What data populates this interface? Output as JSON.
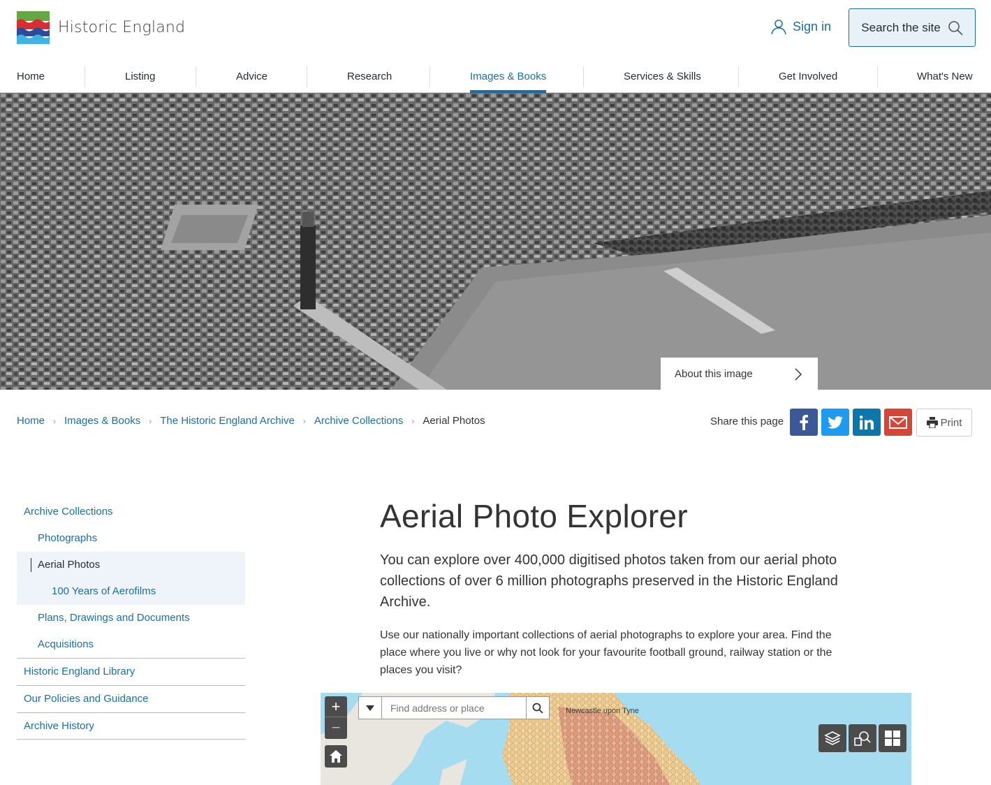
{
  "header": {
    "logo_text": "Historic England",
    "signin_label": "Sign in",
    "search_label": "Search the site"
  },
  "nav": {
    "items": [
      {
        "label": "Home"
      },
      {
        "label": "Listing"
      },
      {
        "label": "Advice"
      },
      {
        "label": "Research"
      },
      {
        "label": "Images & Books",
        "active": true
      },
      {
        "label": "Services & Skills"
      },
      {
        "label": "Get Involved"
      },
      {
        "label": "What's New"
      }
    ]
  },
  "hero": {
    "about_label": "About this image"
  },
  "breadcrumb": {
    "items": [
      "Home",
      "Images & Books",
      "The Historic England Archive",
      "Archive Collections"
    ],
    "current": "Aerial Photos"
  },
  "share": {
    "label": "Share this page",
    "print_label": "Print",
    "colors": {
      "facebook": "#3b5998",
      "twitter": "#1d9bf0",
      "linkedin": "#0e76a8",
      "email": "#d44638"
    }
  },
  "sidebar": {
    "items": [
      {
        "label": "Archive Collections"
      },
      {
        "label": "Photographs"
      },
      {
        "label": "Aerial Photos"
      },
      {
        "label": "100 Years of Aerofilms"
      },
      {
        "label": "Plans, Drawings and Documents"
      },
      {
        "label": "Acquisitions"
      },
      {
        "label": "Historic England Library"
      },
      {
        "label": "Our Policies and Guidance"
      },
      {
        "label": "Archive History"
      }
    ]
  },
  "main": {
    "title": "Aerial Photo Explorer",
    "lead": "You can explore over 400,000 digitised photos taken from our aerial photo collections of over 6 million photographs preserved in the Historic England Archive.",
    "body": "Use our nationally important collections of aerial photographs to explore your area. Find the place where you live or why not look for your favourite football ground, railway station or the places you visit?"
  },
  "map": {
    "search_placeholder": "Find address or place",
    "zoom_in": "+",
    "zoom_out": "−",
    "place_label": "Newcastle upon Tyne",
    "icons": [
      "layers-icon",
      "map-search-icon",
      "basemap-gallery-icon"
    ]
  },
  "brand_colors": {
    "accent": "#1a6fa0"
  }
}
